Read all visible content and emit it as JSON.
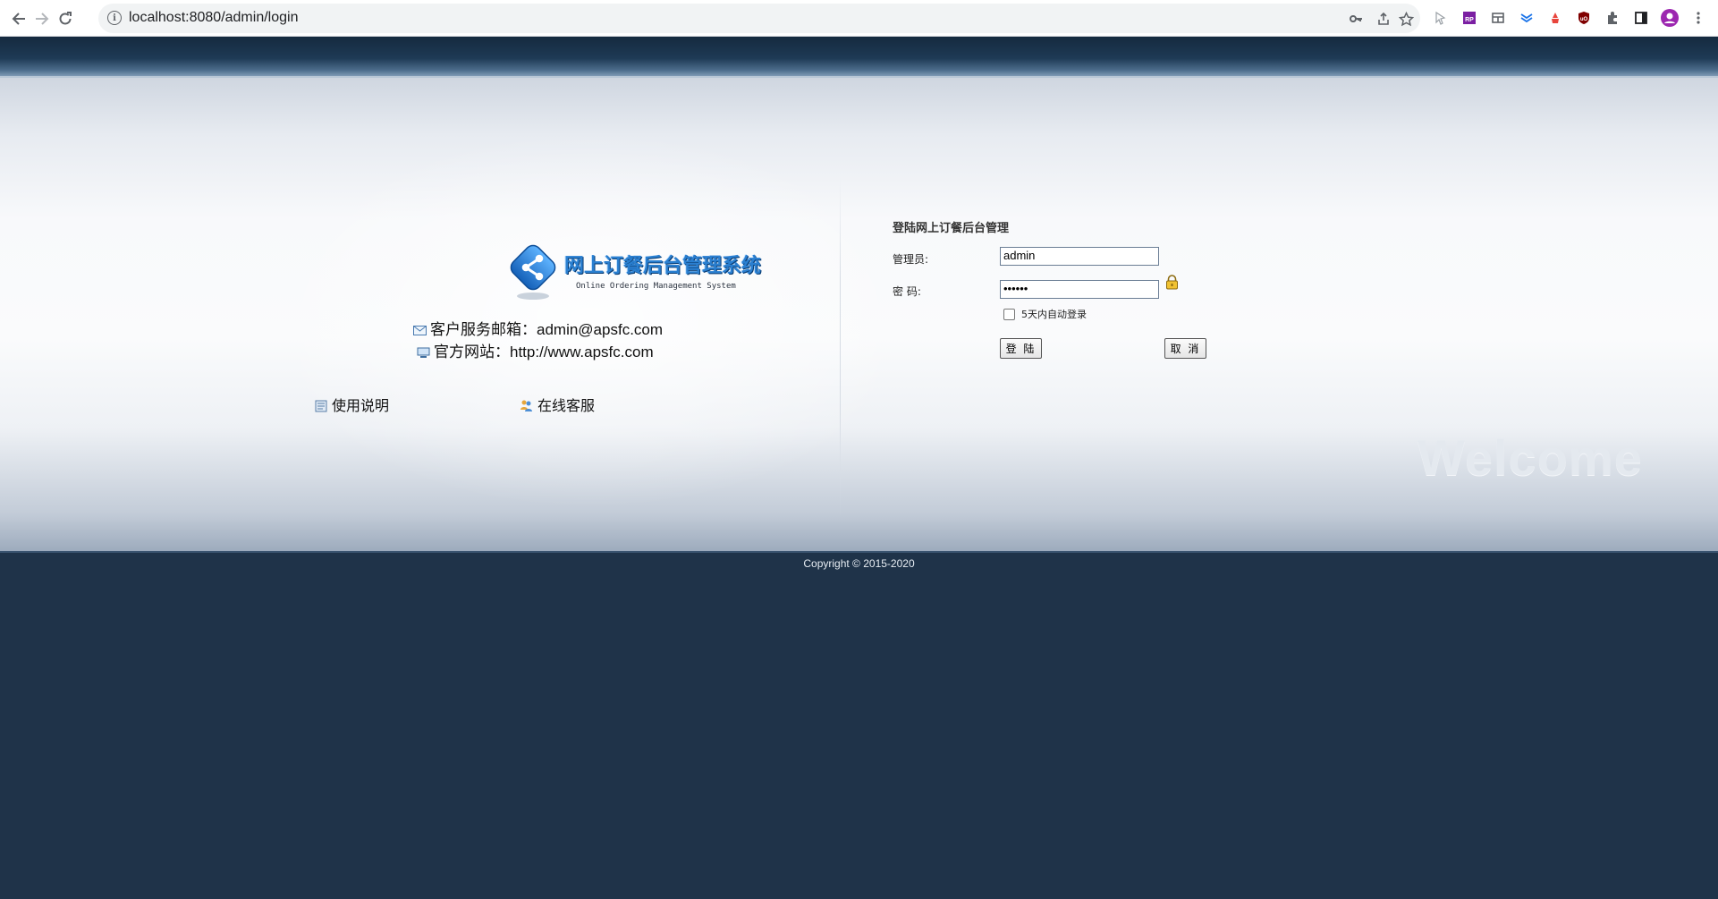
{
  "browser": {
    "url": "localhost:8080/admin/login",
    "extensions": [
      "pointer-icon",
      "rp-icon",
      "store-icon",
      "download-icon",
      "fire-icon",
      "ublock-icon",
      "puzzle-icon",
      "sidepanel-icon",
      "profile-avatar",
      "more-icon"
    ]
  },
  "logo": {
    "title": "网上订餐后台管理系统",
    "subtitle": "Online Ordering Management System"
  },
  "contact": {
    "email": "客户服务邮箱：admin@apsfc.com",
    "website": "官方网站：http://www.apsfc.com"
  },
  "links": {
    "help": "使用说明",
    "online_service": "在线客服"
  },
  "form": {
    "title": "登陆网上订餐后台管理",
    "user_label": "管理员:",
    "user_value": "admin",
    "password_label": "密 码:",
    "password_value": "••••••",
    "remember_label": "5天内自动登录",
    "remember_checked": false,
    "login_button": "登 陆",
    "cancel_button": "取 消"
  },
  "welcome_text": "Welcome",
  "footer": {
    "copyright": "Copyright © 2015-2020"
  },
  "colors": {
    "header_dark": "#1f3349",
    "logo_blue": "#2a7fd0",
    "page_light": "#f8f9fb"
  }
}
